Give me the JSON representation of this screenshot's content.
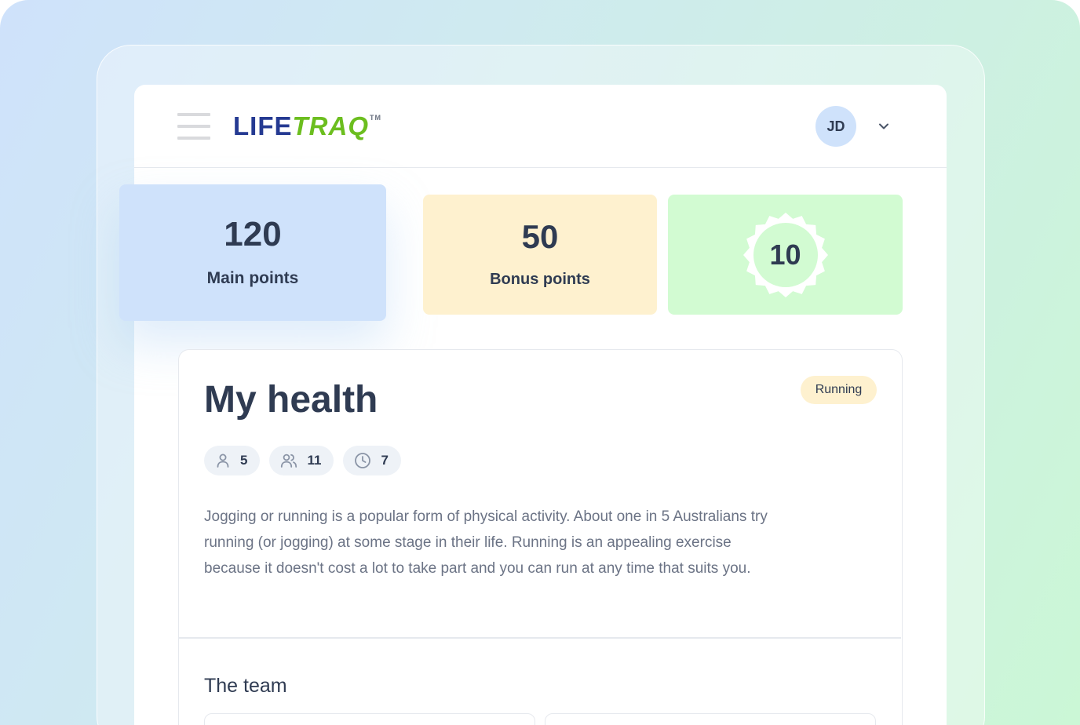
{
  "app": {
    "brand_part1": "LIFE",
    "brand_part2": "TRAQ",
    "brand_tm": "TM"
  },
  "header": {
    "user_initials": "JD",
    "menu_icon": "hamburger-icon",
    "dropdown_icon": "chevron-down-icon"
  },
  "points": {
    "main": {
      "value": "120",
      "label": "Main points"
    },
    "bonus": {
      "value": "50",
      "label": "Bonus points"
    },
    "badge": {
      "value": "10"
    }
  },
  "health": {
    "title": "My health",
    "status": "Running",
    "stats": [
      {
        "icon": "user-icon",
        "value": "5"
      },
      {
        "icon": "users-icon",
        "value": "11"
      },
      {
        "icon": "clock-icon",
        "value": "7"
      }
    ],
    "description": "Jogging or running is a popular form of physical activity. About one in 5 Australians try running (or jogging) at some stage in their life. Running is an appealing exercise because it doesn't cost a lot to take part and you can run at any time that suits you.",
    "team_title": "The team"
  },
  "colors": {
    "main_card": "#cfe2fb",
    "bonus_card": "#fef1cf",
    "badge_card": "#d2fbd2",
    "brand_blue": "#253a92",
    "brand_green": "#6cbe1f",
    "text_dark": "#2f3b52"
  }
}
